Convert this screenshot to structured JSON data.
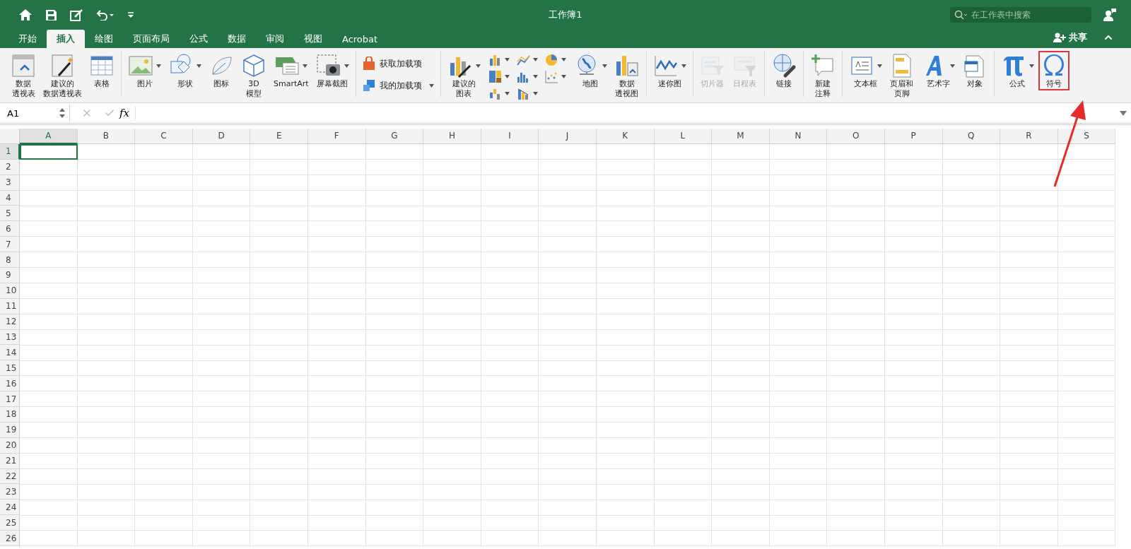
{
  "window": {
    "title": "工作簿1"
  },
  "search": {
    "placeholder": "在工作表中搜索"
  },
  "tabs": [
    {
      "label": "开始",
      "selected": false
    },
    {
      "label": "插入",
      "selected": true
    },
    {
      "label": "绘图",
      "selected": false
    },
    {
      "label": "页面布局",
      "selected": false
    },
    {
      "label": "公式",
      "selected": false
    },
    {
      "label": "数据",
      "selected": false
    },
    {
      "label": "审阅",
      "selected": false
    },
    {
      "label": "视图",
      "selected": false
    },
    {
      "label": "Acrobat",
      "selected": false
    }
  ],
  "share": {
    "label": "共享"
  },
  "ribbon_groups": [
    {
      "items": [
        {
          "kind": "large",
          "lines": [
            "数据",
            "透视表"
          ]
        },
        {
          "kind": "large",
          "lines": [
            "建议的",
            "数据透视表"
          ]
        },
        {
          "kind": "large",
          "lines": [
            "表格"
          ]
        }
      ]
    },
    {
      "items": [
        {
          "kind": "large",
          "lines": [
            "图片"
          ],
          "dropdown": true
        },
        {
          "kind": "large",
          "lines": [
            "形状"
          ],
          "dropdown": true
        },
        {
          "kind": "large",
          "lines": [
            "图标"
          ]
        },
        {
          "kind": "large",
          "lines": [
            "3D",
            "模型"
          ]
        },
        {
          "kind": "large",
          "lines": [
            "SmartArt"
          ],
          "dropdown": true
        },
        {
          "kind": "large",
          "lines": [
            "屏幕截图"
          ],
          "dropdown": true
        }
      ]
    },
    {
      "items": [
        {
          "kind": "small",
          "label": "获取加载项"
        },
        {
          "kind": "small",
          "label": "我的加载项",
          "dropdown": true
        }
      ]
    },
    {
      "items": [
        {
          "kind": "large",
          "lines": [
            "建议的",
            "图表"
          ],
          "dropdown": true
        },
        {
          "kind": "chart-grid"
        },
        {
          "kind": "large",
          "lines": [
            "地图"
          ],
          "dropdown": true
        },
        {
          "kind": "large",
          "lines": [
            "数据",
            "透视图"
          ]
        }
      ]
    },
    {
      "items": [
        {
          "kind": "large",
          "lines": [
            "迷你图"
          ],
          "dropdown": true
        }
      ]
    },
    {
      "items": [
        {
          "kind": "large",
          "lines": [
            "切片器"
          ],
          "disabled": true
        },
        {
          "kind": "large",
          "lines": [
            "日程表"
          ],
          "disabled": true
        }
      ]
    },
    {
      "items": [
        {
          "kind": "large",
          "lines": [
            "链接"
          ]
        }
      ]
    },
    {
      "items": [
        {
          "kind": "large",
          "lines": [
            "新建",
            "注释"
          ]
        }
      ]
    },
    {
      "items": [
        {
          "kind": "large",
          "lines": [
            "文本框"
          ],
          "dropdown": true
        },
        {
          "kind": "large",
          "lines": [
            "页眉和",
            "页脚"
          ]
        },
        {
          "kind": "large",
          "lines": [
            "艺术字"
          ],
          "dropdown": true
        },
        {
          "kind": "large",
          "lines": [
            "对象"
          ]
        }
      ]
    },
    {
      "items": [
        {
          "kind": "large",
          "lines": [
            "公式"
          ],
          "dropdown": true
        },
        {
          "kind": "large",
          "lines": [
            "符号"
          ],
          "highlighted": true
        }
      ]
    }
  ],
  "formula_bar": {
    "name_box": "A1",
    "fx": "fx"
  },
  "sheet": {
    "columns": [
      {
        "label": "A",
        "selected": true
      },
      {
        "label": "B",
        "selected": false
      },
      {
        "label": "C",
        "selected": false
      },
      {
        "label": "D",
        "selected": false
      },
      {
        "label": "E",
        "selected": false
      },
      {
        "label": "F",
        "selected": false
      },
      {
        "label": "G",
        "selected": false
      },
      {
        "label": "H",
        "selected": false
      },
      {
        "label": "I",
        "selected": false
      },
      {
        "label": "J",
        "selected": false
      },
      {
        "label": "K",
        "selected": false
      },
      {
        "label": "L",
        "selected": false
      },
      {
        "label": "M",
        "selected": false
      },
      {
        "label": "N",
        "selected": false
      },
      {
        "label": "O",
        "selected": false
      },
      {
        "label": "P",
        "selected": false
      },
      {
        "label": "Q",
        "selected": false
      },
      {
        "label": "R",
        "selected": false
      },
      {
        "label": "S",
        "selected": false
      }
    ],
    "rows": [
      {
        "label": "1",
        "selected": true
      },
      {
        "label": "2",
        "selected": false
      },
      {
        "label": "3",
        "selected": false
      },
      {
        "label": "4",
        "selected": false
      },
      {
        "label": "5",
        "selected": false
      },
      {
        "label": "6",
        "selected": false
      },
      {
        "label": "7",
        "selected": false
      },
      {
        "label": "8",
        "selected": false
      },
      {
        "label": "9",
        "selected": false
      },
      {
        "label": "10",
        "selected": false
      },
      {
        "label": "11",
        "selected": false
      },
      {
        "label": "12",
        "selected": false
      },
      {
        "label": "13",
        "selected": false
      },
      {
        "label": "14",
        "selected": false
      },
      {
        "label": "15",
        "selected": false
      },
      {
        "label": "16",
        "selected": false
      },
      {
        "label": "17",
        "selected": false
      },
      {
        "label": "18",
        "selected": false
      },
      {
        "label": "19",
        "selected": false
      },
      {
        "label": "20",
        "selected": false
      },
      {
        "label": "21",
        "selected": false
      },
      {
        "label": "22",
        "selected": false
      },
      {
        "label": "23",
        "selected": false
      },
      {
        "label": "24",
        "selected": false
      },
      {
        "label": "25",
        "selected": false
      },
      {
        "label": "26",
        "selected": false
      }
    ]
  },
  "pointer_arrow": true
}
